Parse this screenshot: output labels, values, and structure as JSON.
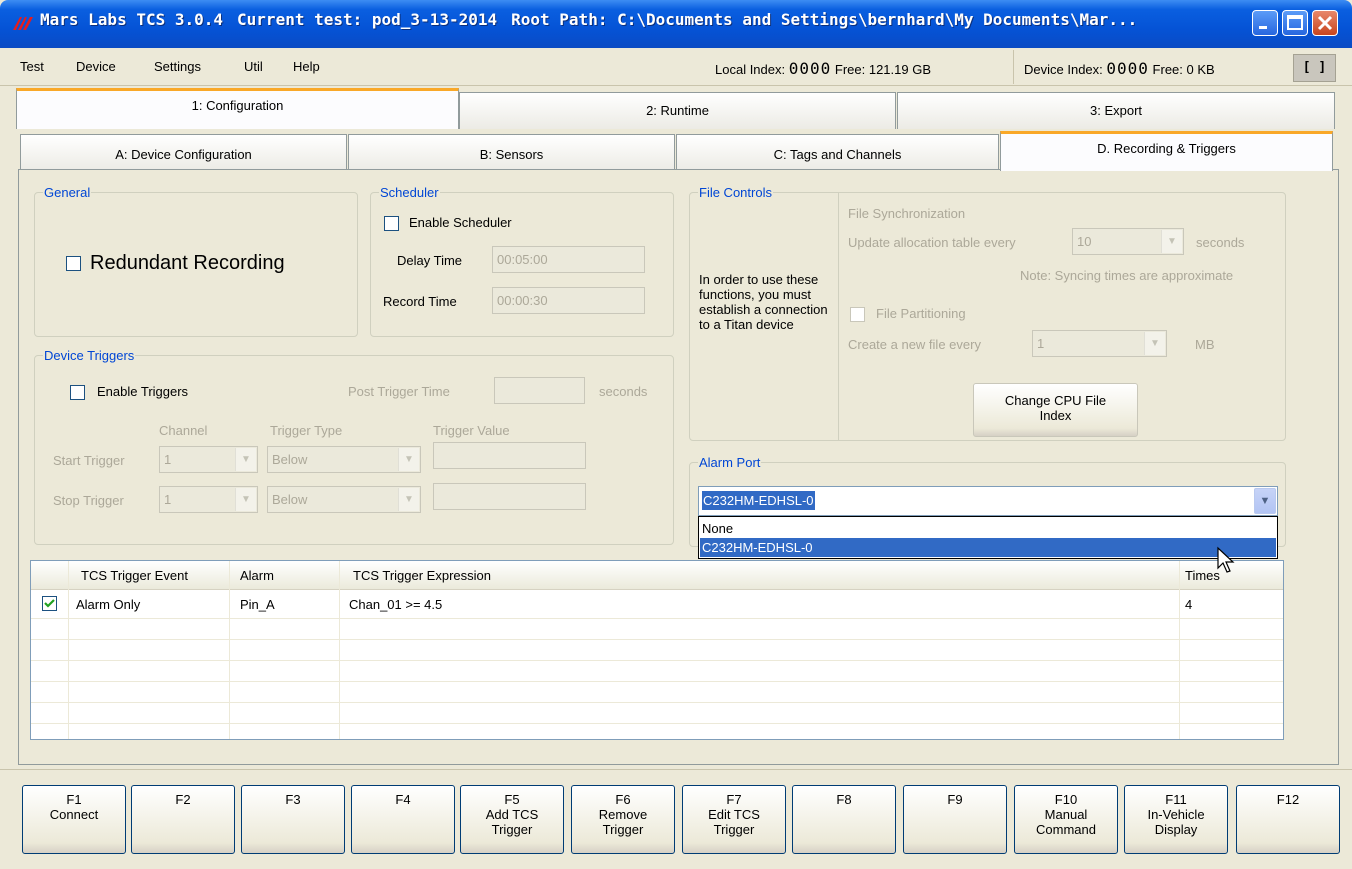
{
  "window": {
    "title_app": "Mars Labs TCS  3.0.4",
    "title_test": "Current test: pod_3-13-2014",
    "title_path": "Root Path: C:\\Documents and Settings\\bernhard\\My Documents\\Mar..."
  },
  "menu": {
    "items": [
      "Test",
      "Device",
      "Settings",
      "Util",
      "Help"
    ],
    "local_index_label": "Local Index:",
    "local_index_value": "0000",
    "local_free": "Free:  121.19 GB",
    "device_index_label": "Device Index:",
    "device_index_value": "0000",
    "device_free": "Free:  0 KB",
    "device_box": "[ ]"
  },
  "tabs_main": [
    "1: Configuration",
    "2: Runtime",
    "3: Export"
  ],
  "tabs_sub": [
    "A: Device Configuration",
    "B: Sensors",
    "C: Tags and Channels",
    "D. Recording & Triggers"
  ],
  "general": {
    "legend": "General",
    "redundant_label": "Redundant Recording"
  },
  "scheduler": {
    "legend": "Scheduler",
    "enable_label": "Enable Scheduler",
    "delay_label": "Delay Time",
    "delay_value": "00:05:00",
    "record_label": "Record Time",
    "record_value": "00:00:30"
  },
  "file_controls": {
    "legend": "File Controls",
    "note": "In order to use these functions, you must establish a connection to a Titan device",
    "sync_label": "File Synchronization",
    "update_label": "Update allocation table every",
    "update_value": "10",
    "seconds_label": "seconds",
    "sync_note": "Note: Syncing times are approximate",
    "partition_label": "File Partitioning",
    "create_label": "Create a new file every",
    "create_value": "1",
    "mb_label": "MB",
    "change_cpu_line1": "Change CPU File",
    "change_cpu_line2": "Index"
  },
  "device_triggers": {
    "legend": "Device Triggers",
    "enable_label": "Enable Triggers",
    "post_label": "Post Trigger Time",
    "post_unit": "seconds",
    "col_channel": "Channel",
    "col_type": "Trigger Type",
    "col_value": "Trigger Value",
    "start_label": "Start Trigger",
    "start_channel": "1",
    "start_type": "Below",
    "stop_label": "Stop Trigger",
    "stop_channel": "1",
    "stop_type": "Below"
  },
  "alarm_port": {
    "legend": "Alarm Port",
    "value": "C232HM-EDHSL-0",
    "options": [
      "None",
      "C232HM-EDHSL-0"
    ]
  },
  "grid": {
    "headers": [
      "TCS Trigger Event",
      "Alarm",
      "TCS Trigger Expression",
      "Times"
    ],
    "rows": [
      {
        "checked": true,
        "event": "Alarm Only",
        "alarm": "Pin_A",
        "expression": "Chan_01 >= 4.5",
        "times": "4"
      }
    ]
  },
  "fkeys": [
    {
      "key": "F1",
      "l1": "Connect",
      "l2": ""
    },
    {
      "key": "F2",
      "l1": "",
      "l2": ""
    },
    {
      "key": "F3",
      "l1": "",
      "l2": ""
    },
    {
      "key": "F4",
      "l1": "",
      "l2": ""
    },
    {
      "key": "F5",
      "l1": "Add TCS",
      "l2": "Trigger"
    },
    {
      "key": "F6",
      "l1": "Remove",
      "l2": "Trigger"
    },
    {
      "key": "F7",
      "l1": "Edit TCS",
      "l2": "Trigger"
    },
    {
      "key": "F8",
      "l1": "",
      "l2": ""
    },
    {
      "key": "F9",
      "l1": "",
      "l2": ""
    },
    {
      "key": "F10",
      "l1": "Manual",
      "l2": "Command"
    },
    {
      "key": "F11",
      "l1": "In-Vehicle",
      "l2": "Display"
    },
    {
      "key": "F12",
      "l1": "",
      "l2": ""
    }
  ],
  "icons": {
    "app": "mars-labs-logo-icon",
    "minimize": "minimize-icon",
    "maximize": "maximize-icon",
    "close": "close-icon",
    "dropdown": "chevron-down-icon",
    "check": "checkmark-icon",
    "cursor": "mouse-pointer-icon"
  },
  "colors": {
    "titlebar": "#0553d6",
    "legend_text": "#0046d5",
    "active_tab_accent": "#f9a828",
    "selection": "#316ac5"
  }
}
